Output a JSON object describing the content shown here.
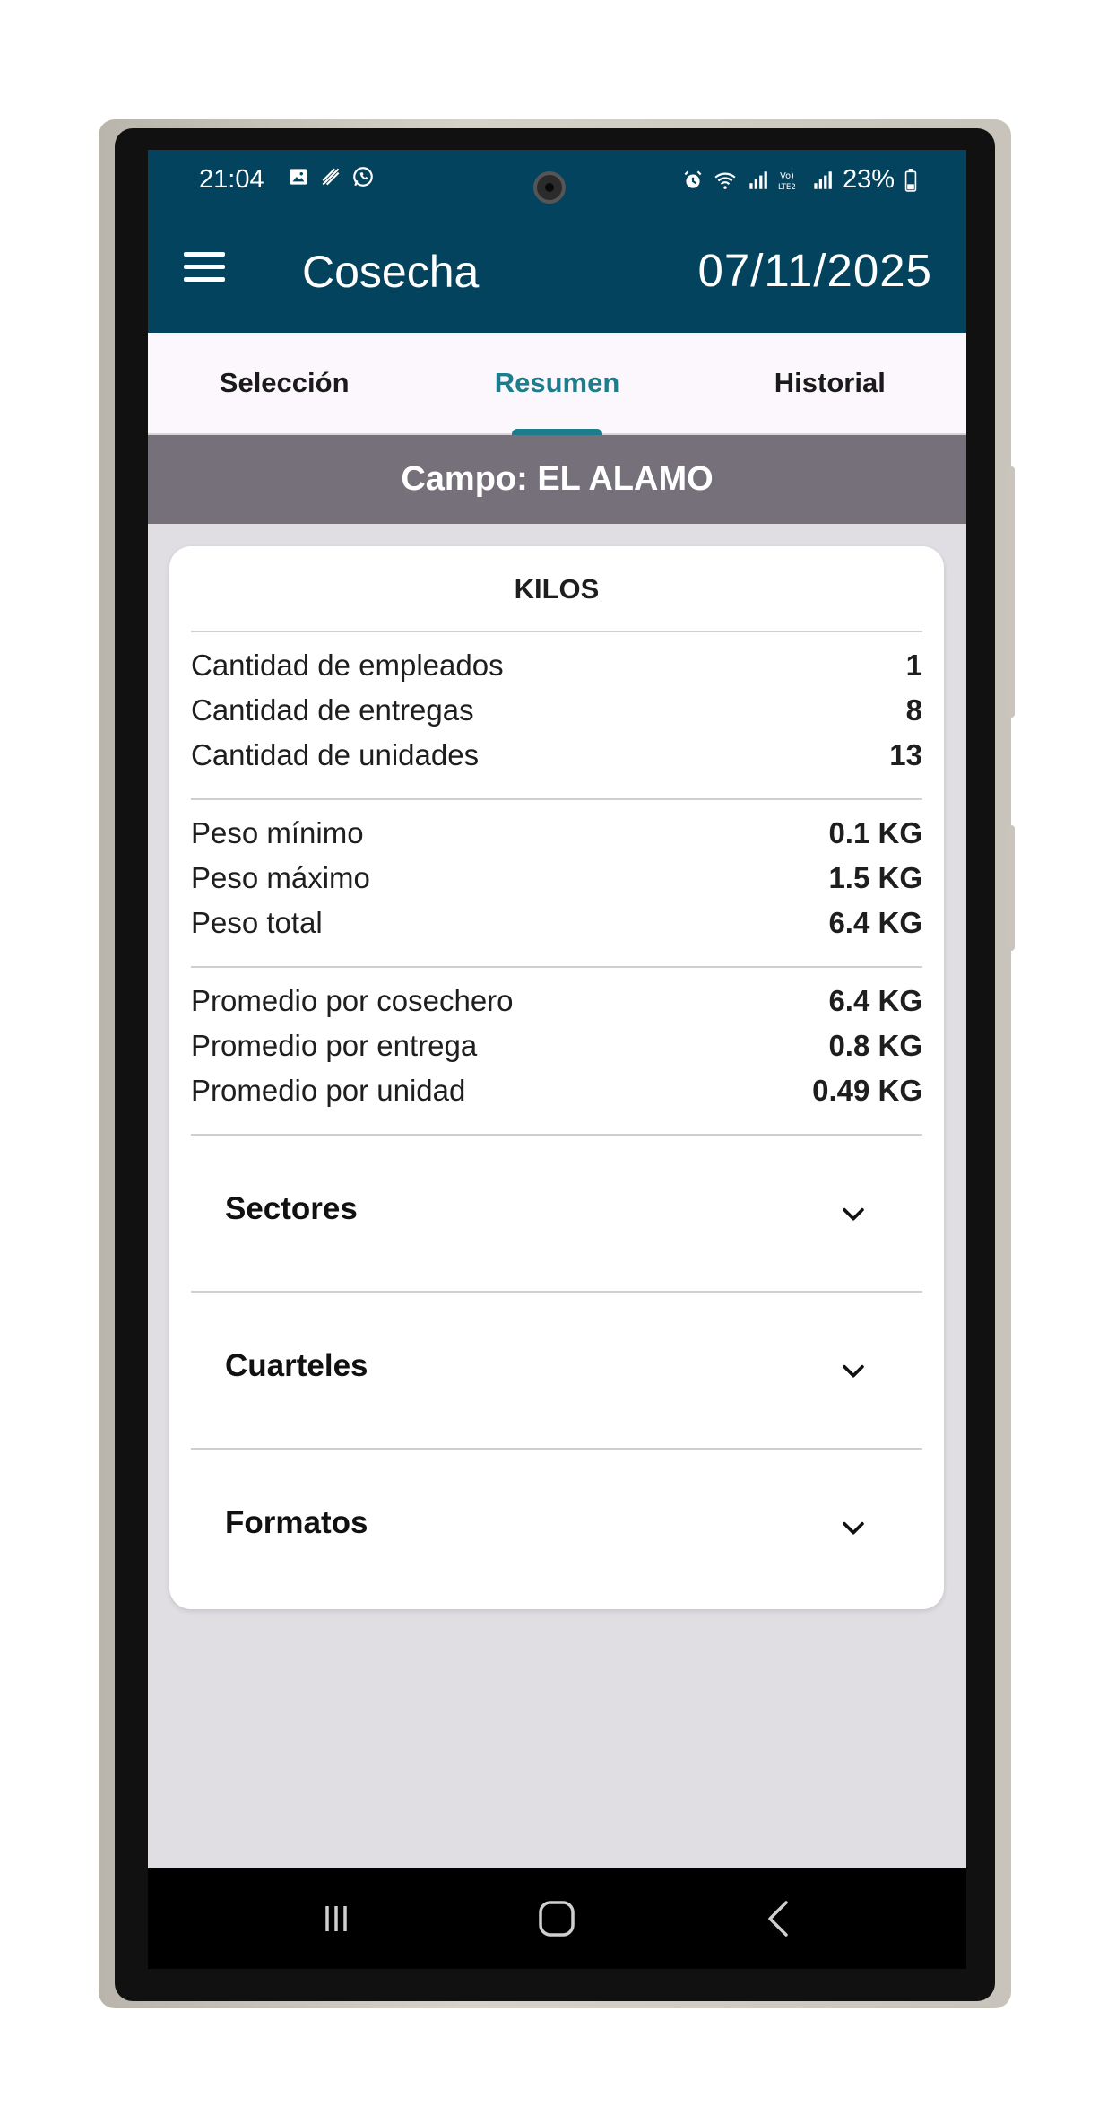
{
  "status_bar": {
    "time": "21:04",
    "left_icons": [
      "image-icon",
      "slash-icon",
      "whatsapp-icon"
    ],
    "right_icons": [
      "alarm-icon",
      "wifi-icon",
      "signal-icon",
      "volte-icon",
      "signal-icon"
    ],
    "battery": "23%"
  },
  "app_bar": {
    "title": "Cosecha",
    "date": "07/11/2025"
  },
  "tabs": [
    {
      "label": "Selección",
      "active": false
    },
    {
      "label": "Resumen",
      "active": true
    },
    {
      "label": "Historial",
      "active": false
    }
  ],
  "campo": "Campo: EL ALAMO",
  "card": {
    "title": "KILOS",
    "counts": [
      {
        "label": "Cantidad de empleados",
        "value": "1"
      },
      {
        "label": "Cantidad de entregas",
        "value": "8"
      },
      {
        "label": "Cantidad de unidades",
        "value": "13"
      }
    ],
    "weights": [
      {
        "label": "Peso mínimo",
        "value": "0.1 KG"
      },
      {
        "label": "Peso máximo",
        "value": "1.5 KG"
      },
      {
        "label": "Peso total",
        "value": "6.4 KG"
      }
    ],
    "averages": [
      {
        "label": "Promedio por cosechero",
        "value": "6.4 KG"
      },
      {
        "label": "Promedio por entrega",
        "value": "0.8 KG"
      },
      {
        "label": "Promedio por unidad",
        "value": "0.49 KG"
      }
    ],
    "sections": [
      {
        "label": "Sectores"
      },
      {
        "label": "Cuarteles"
      },
      {
        "label": "Formatos"
      }
    ]
  },
  "colors": {
    "app_bar": "#03435e",
    "accent": "#1c7d8c",
    "campo_bar": "#76707a",
    "background": "#e0dde3"
  },
  "nav_bar": [
    "recents-icon",
    "home-icon",
    "back-icon"
  ]
}
